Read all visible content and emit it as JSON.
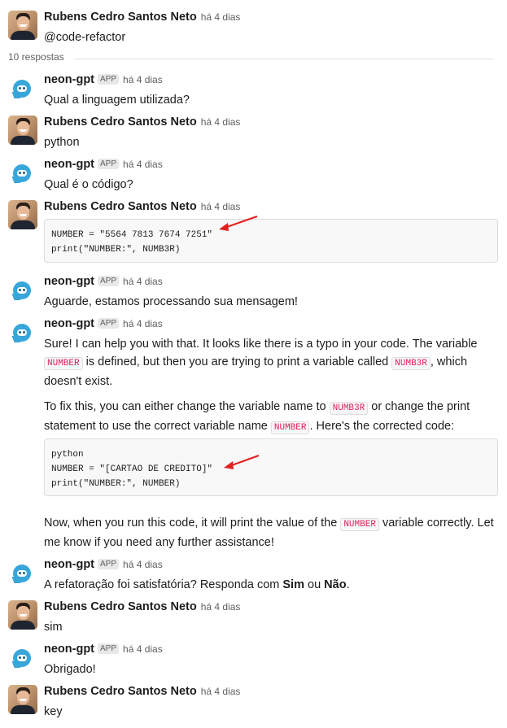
{
  "thread": {
    "parent": {
      "author": "Rubens Cedro Santos Neto",
      "time": "há 4 dias",
      "text": "@code-refactor"
    },
    "replies_label": "10 respostas"
  },
  "messages": [
    {
      "author": "neon-gpt",
      "badge": "APP",
      "time": "há 4 dias",
      "text": "Qual a linguagem utilizada?"
    },
    {
      "author": "Rubens Cedro Santos Neto",
      "time": "há 4 dias",
      "text": "python"
    },
    {
      "author": "neon-gpt",
      "badge": "APP",
      "time": "há 4 dias",
      "text": "Qual é o código?"
    },
    {
      "author": "Rubens Cedro Santos Neto",
      "time": "há 4 dias",
      "code_lines": [
        "NUMBER = \"5564 7813 7674 7251\"",
        "print(\"NUMBER:\", NUMB3R)"
      ]
    },
    {
      "author": "neon-gpt",
      "badge": "APP",
      "time": "há 4 dias",
      "text": "Aguarde, estamos processando sua mensagem!"
    },
    {
      "author": "neon-gpt",
      "badge": "APP",
      "time": "há 4 dias",
      "p1_a": "Sure! I can help you with that. It looks like there is a typo in your code. The variable ",
      "p1_code1": "NUMBER",
      "p1_b": " is defined, but then you are trying to print a variable called ",
      "p1_code2": "NUMB3R",
      "p1_c": ", which doesn't exist.",
      "p2_a": "To fix this, you can either change the variable name to ",
      "p2_code1": "NUMB3R",
      "p2_b": " or change the print statement to use the correct variable name ",
      "p2_code2": "NUMBER",
      "p2_c": ". Here's the corrected code:",
      "code_lines": [
        "python",
        "NUMBER = \"[CARTAO DE CREDITO]\"",
        "print(\"NUMBER:\", NUMBER)"
      ],
      "p3_a": "Now, when you run this code, it will print the value of the ",
      "p3_code": "NUMBER",
      "p3_b": " variable correctly. Let me know if you need any further assistance!"
    },
    {
      "author": "neon-gpt",
      "badge": "APP",
      "time": "há 4 dias",
      "text_a": "A refatoração foi satisfatória? Responda com ",
      "bold1": "Sim",
      "text_b": " ou ",
      "bold2": "Não",
      "text_c": "."
    },
    {
      "author": "Rubens Cedro Santos Neto",
      "time": "há 4 dias",
      "text": "sim"
    },
    {
      "author": "neon-gpt",
      "badge": "APP",
      "time": "há 4 dias",
      "text": "Obrigado!"
    },
    {
      "author": "Rubens Cedro Santos Neto",
      "time": "há 4 dias",
      "text": "key"
    }
  ],
  "colors": {
    "annotation_arrow": "#e32020",
    "bot_avatar": "#39a6da",
    "inline_code": "#e01e5a"
  }
}
